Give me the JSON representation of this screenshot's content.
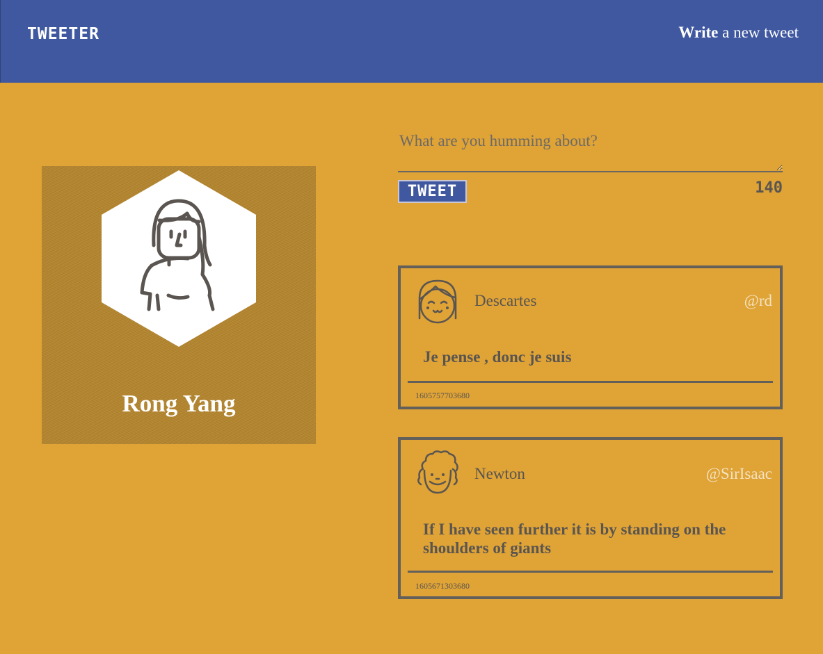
{
  "nav": {
    "brand": "TWEETER",
    "compose_bold": "Write",
    "compose_rest": " a new tweet"
  },
  "profile": {
    "name": "Rong Yang",
    "avatar_icon": "woman-avatar-icon"
  },
  "composer": {
    "placeholder": "What are you humming about?",
    "value": "",
    "submit_label": "TWEET",
    "char_count": "140"
  },
  "tweets": [
    {
      "name": "Descartes",
      "handle": "@rd",
      "text": "Je pense , donc je suis",
      "timestamp": "1605757703680",
      "avatar_icon": "girl-avatar-icon"
    },
    {
      "name": "Newton",
      "handle": "@SirIsaac",
      "text": "If I have seen further it is by standing on the shoulders of giants",
      "timestamp": "1605671303680",
      "avatar_icon": "curly-hair-man-avatar-icon"
    }
  ],
  "colors": {
    "nav_bg": "#3f58a0",
    "page_bg": "#dfa336",
    "text": "#5a5550",
    "handle": "#f4e2c0"
  }
}
